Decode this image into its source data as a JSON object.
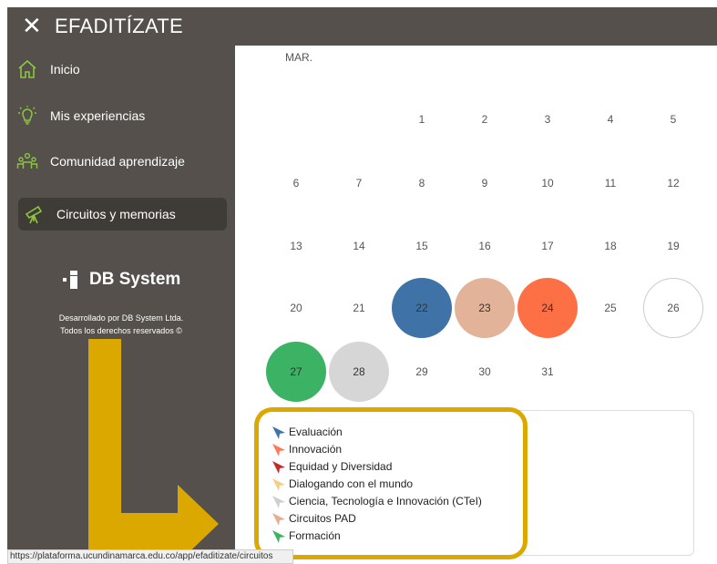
{
  "app": {
    "title": "EFADITÍZATE",
    "close_icon": "close-icon"
  },
  "sidebar": {
    "items": [
      {
        "label": "Inicio",
        "icon": "home-icon"
      },
      {
        "label": "Mis experiencias",
        "icon": "lightbulb-icon"
      },
      {
        "label": "Comunidad aprendizaje",
        "icon": "community-icon"
      },
      {
        "label": "Circuitos y memorias",
        "icon": "telescope-icon",
        "active": true
      }
    ],
    "brand": "DB System",
    "credits_line1": "Desarrollado por DB System Ltda.",
    "credits_line2": "Todos los derechos reservados ©"
  },
  "calendar": {
    "month": "MAR.",
    "days": [
      {
        "n": "1"
      },
      {
        "n": "2"
      },
      {
        "n": "3"
      },
      {
        "n": "4"
      },
      {
        "n": "5"
      },
      {
        "n": "6"
      },
      {
        "n": "7"
      },
      {
        "n": "8"
      },
      {
        "n": "9"
      },
      {
        "n": "10"
      },
      {
        "n": "11"
      },
      {
        "n": "12"
      },
      {
        "n": "13"
      },
      {
        "n": "14"
      },
      {
        "n": "15"
      },
      {
        "n": "16"
      },
      {
        "n": "17"
      },
      {
        "n": "18"
      },
      {
        "n": "19"
      },
      {
        "n": "20"
      },
      {
        "n": "21"
      },
      {
        "n": "22",
        "color": "#3f73a8"
      },
      {
        "n": "23",
        "color": "#e3b399"
      },
      {
        "n": "24",
        "color": "#fd6f45"
      },
      {
        "n": "25"
      },
      {
        "n": "26",
        "outlined": true
      },
      {
        "n": "27",
        "color": "#3cb364"
      },
      {
        "n": "28",
        "color": "#d6d6d6"
      },
      {
        "n": "29"
      },
      {
        "n": "30"
      },
      {
        "n": "31"
      }
    ]
  },
  "legend": [
    {
      "label": "Evaluación",
      "color": "#3f73a8"
    },
    {
      "label": "Innovación",
      "color": "#fd7a55"
    },
    {
      "label": "Equidad y Diversidad",
      "color": "#c62b2b"
    },
    {
      "label": "Dialogando con el mundo",
      "color": "#f3cf84"
    },
    {
      "label": "Ciencia, Tecnología e Innovación (CTeI)",
      "color": "#cfcfcf"
    },
    {
      "label": "Circuitos PAD",
      "color": "#e6ad94"
    },
    {
      "label": "Formación",
      "color": "#3cb364"
    }
  ],
  "status_bar": {
    "url": "https://plataforma.ucundinamarca.edu.co/app/efaditizate/circuitos"
  },
  "annotation": {
    "color": "#dba800"
  }
}
